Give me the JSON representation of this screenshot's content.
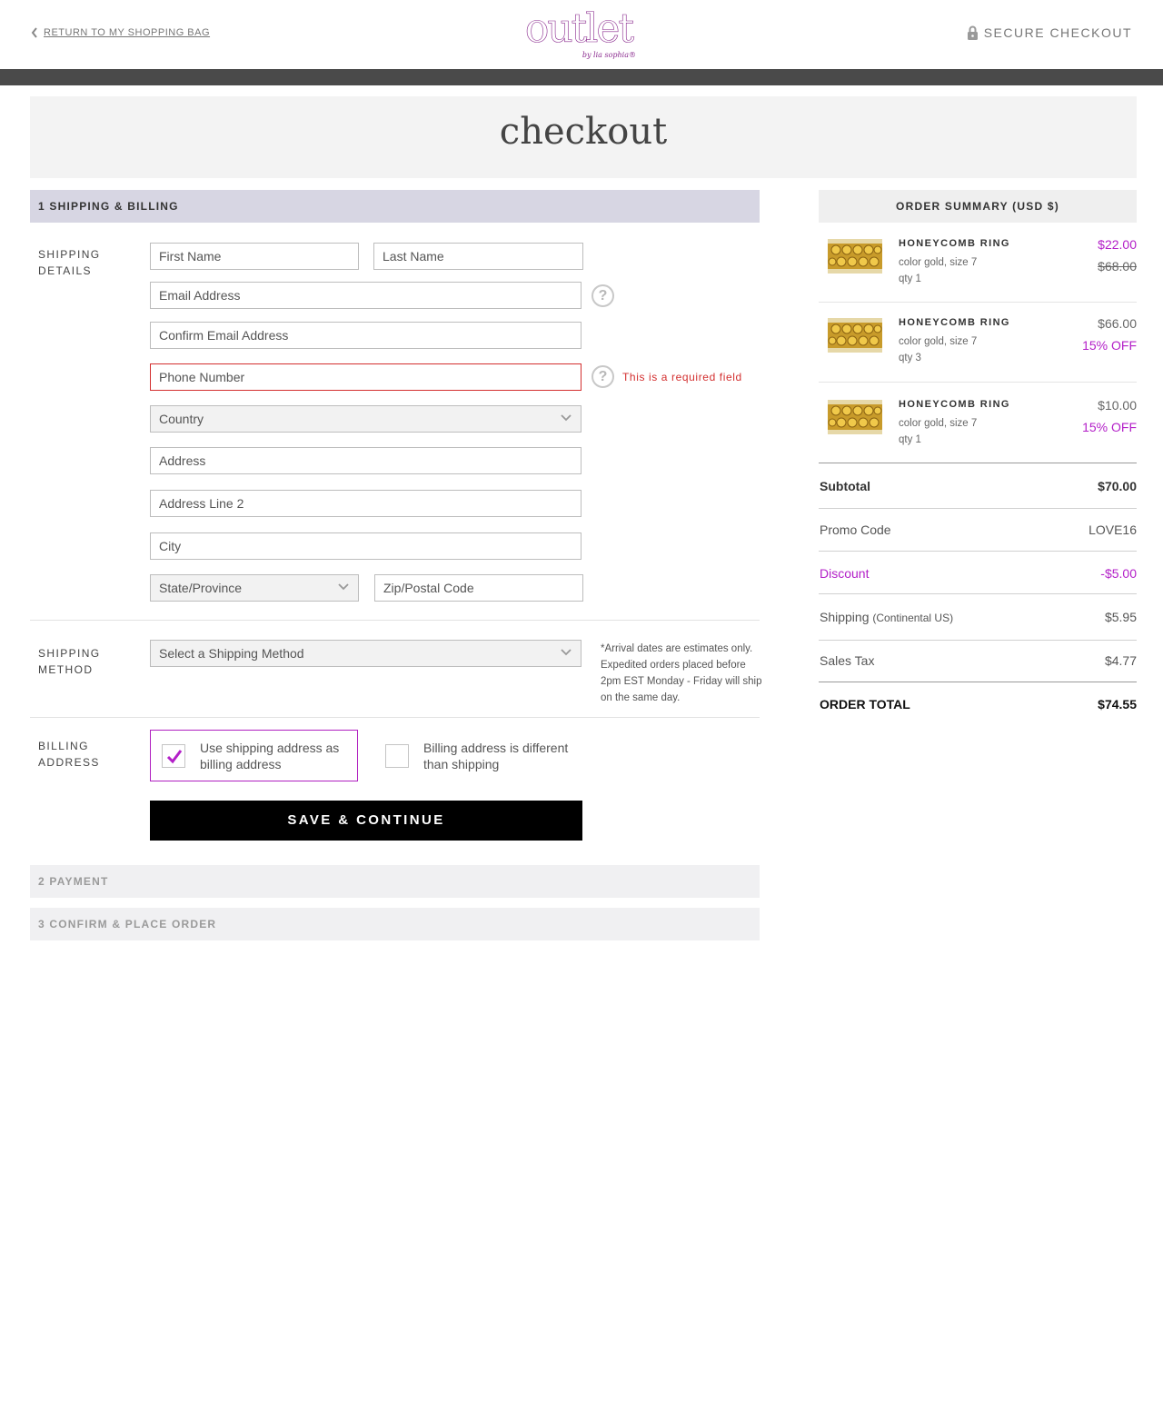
{
  "header": {
    "back_link": "RETURN TO MY SHOPPING BAG",
    "logo_word": "outlet",
    "logo_sub": "by lia sophia®",
    "secure_label": "SECURE CHECKOUT"
  },
  "page_title": "checkout",
  "steps": {
    "step1": "1 SHIPPING & BILLING",
    "step2": "2 PAYMENT",
    "step3": "3 CONFIRM & PLACE ORDER"
  },
  "shipping_details": {
    "label_line1": "SHIPPING",
    "label_line2": "DETAILS",
    "first_name": "First Name",
    "last_name": "Last Name",
    "email": "Email Address",
    "confirm_email": "Confirm Email Address",
    "phone": "Phone Number",
    "phone_error": "This is a required field",
    "country": "Country",
    "address": "Address",
    "address2": "Address Line 2",
    "city": "City",
    "state": "State/Province",
    "zip": "Zip/Postal Code",
    "help_glyph": "?"
  },
  "shipping_method": {
    "label_line1": "SHIPPING",
    "label_line2": "METHOD",
    "select": "Select a Shipping Method",
    "note": "*Arrival dates are estimates only. Expedited orders placed before 2pm EST Monday - Friday will ship on the same day."
  },
  "billing": {
    "label_line1": "BILLING",
    "label_line2": "ADDRESS",
    "option_same": "Use shipping address as billing address",
    "option_different": "Billing address is different than shipping",
    "same_checked": true
  },
  "save_button": "SAVE & CONTINUE",
  "summary": {
    "title": "ORDER SUMMARY (USD $)",
    "items": [
      {
        "name": "HONEYCOMB RING",
        "color": "color gold, size 7",
        "qty": "qty 1",
        "price": "$22.00",
        "secondary": "$68.00"
      },
      {
        "name": "HONEYCOMB RING",
        "color": "color gold, size 7",
        "qty": "qty 3",
        "price": "$66.00",
        "secondary": "15% OFF"
      },
      {
        "name": "HONEYCOMB RING",
        "color": "color gold, size 7",
        "qty": "qty 1",
        "price": "$10.00",
        "secondary": "15% OFF"
      }
    ],
    "subtotal_label": "Subtotal",
    "subtotal_value": "$70.00",
    "promo_label": "Promo Code",
    "promo_value": "LOVE16",
    "discount_label": "Discount",
    "discount_value": "-$5.00",
    "shipping_label": "Shipping",
    "shipping_note": "(Continental US)",
    "shipping_value": "$5.95",
    "tax_label": "Sales Tax",
    "tax_value": "$4.77",
    "total_label": "ORDER TOTAL",
    "total_value": "$74.55"
  },
  "colors": {
    "brand_purple": "#8a2a8e",
    "accent_magenta": "#b31fc8",
    "error_red": "#d32f2f",
    "step_active_bg": "#d7d6e3"
  }
}
